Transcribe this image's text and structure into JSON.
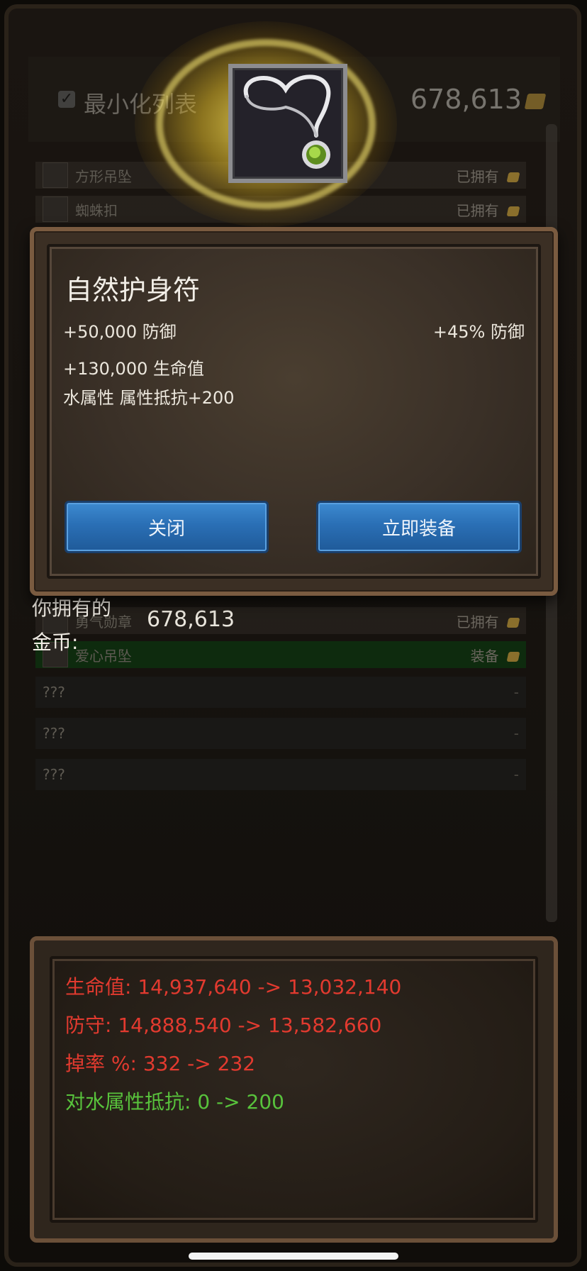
{
  "header": {
    "minimize_label": "最小化列表",
    "gold_amount": "678,613"
  },
  "list": {
    "rows": [
      {
        "name": "方形吊坠",
        "status": "已拥有"
      },
      {
        "name": "蜘蛛扣",
        "status": "已拥有"
      },
      {
        "name": "勇气勋章",
        "status": "已拥有"
      },
      {
        "name": "爱心吊坠",
        "status": "装备"
      }
    ],
    "unknown_rows": [
      {
        "name": "???",
        "status": "-"
      },
      {
        "name": "???",
        "status": "-"
      },
      {
        "name": "???",
        "status": "-"
      }
    ]
  },
  "gold_info": {
    "label_line1": "你拥有的",
    "label_line2": "金币:",
    "value": "678,613"
  },
  "popup": {
    "item_name": "自然护身符",
    "stat_defense": "+50,000 防御",
    "stat_defense_pct": "+45% 防御",
    "stat_hp": "+130,000 生命值",
    "stat_resist": "水属性 属性抵抗+200",
    "close_label": "关闭",
    "equip_label": "立即装备"
  },
  "comparison": {
    "lines": [
      {
        "text": "生命值: 14,937,640 -> 13,032,140",
        "color": "#e23a2f"
      },
      {
        "text": "防守: 14,888,540 -> 13,582,660",
        "color": "#e23a2f"
      },
      {
        "text": "掉率 %: 332 -> 232",
        "color": "#e23a2f"
      },
      {
        "text": "对水属性抵抗: 0 -> 200",
        "color": "#58c23c"
      }
    ]
  },
  "icons": {
    "item": "pendant-icon",
    "gold": "gold-coin-icon"
  }
}
